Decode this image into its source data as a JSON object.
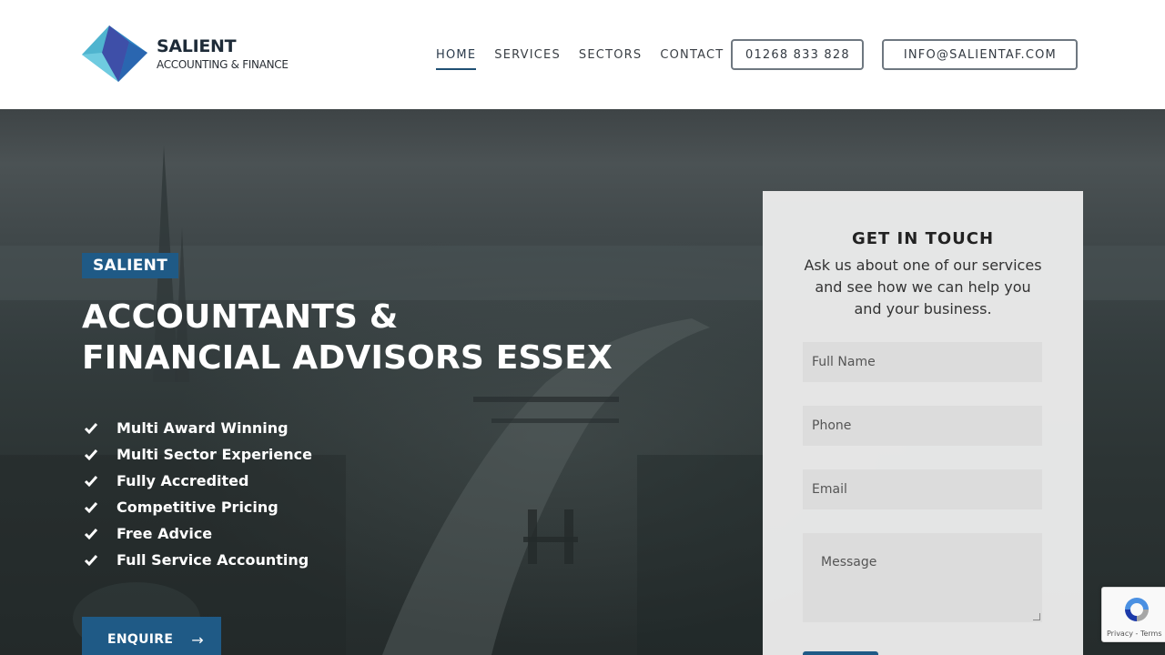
{
  "brand": {
    "name": "SALIENT",
    "tagline": "ACCOUNTING & FINANCE",
    "colors": {
      "primary": "#1f5a86",
      "logo_light": "#4fc3d9",
      "logo_dark": "#2b3f8f"
    }
  },
  "nav": {
    "items": [
      {
        "label": "HOME",
        "active": true
      },
      {
        "label": "SERVICES",
        "active": false
      },
      {
        "label": "SECTORS",
        "active": false
      },
      {
        "label": "CONTACT",
        "active": false
      }
    ],
    "phone": "01268 833 828",
    "email": "INFO@SALIENTAF.COM"
  },
  "hero": {
    "badge": "SALIENT",
    "title_line1": "ACCOUNTANTS &",
    "title_line2": "FINANCIAL ADVISORS ESSEX",
    "features": [
      "Multi Award Winning",
      "Multi Sector Experience",
      "Fully Accredited",
      "Competitive Pricing",
      "Free Advice",
      "Full Service Accounting"
    ],
    "cta_label": "ENQUIRE",
    "cta_icon": "arrow-right-icon"
  },
  "contact_form": {
    "title": "GET IN TOUCH",
    "description": "Ask us about one of our services and see how we can help you and your business.",
    "fields": {
      "name_placeholder": "Full Name",
      "phone_placeholder": "Phone",
      "email_placeholder": "Email",
      "message_placeholder": "Message"
    }
  },
  "recaptcha": {
    "links": "Privacy - Terms"
  }
}
